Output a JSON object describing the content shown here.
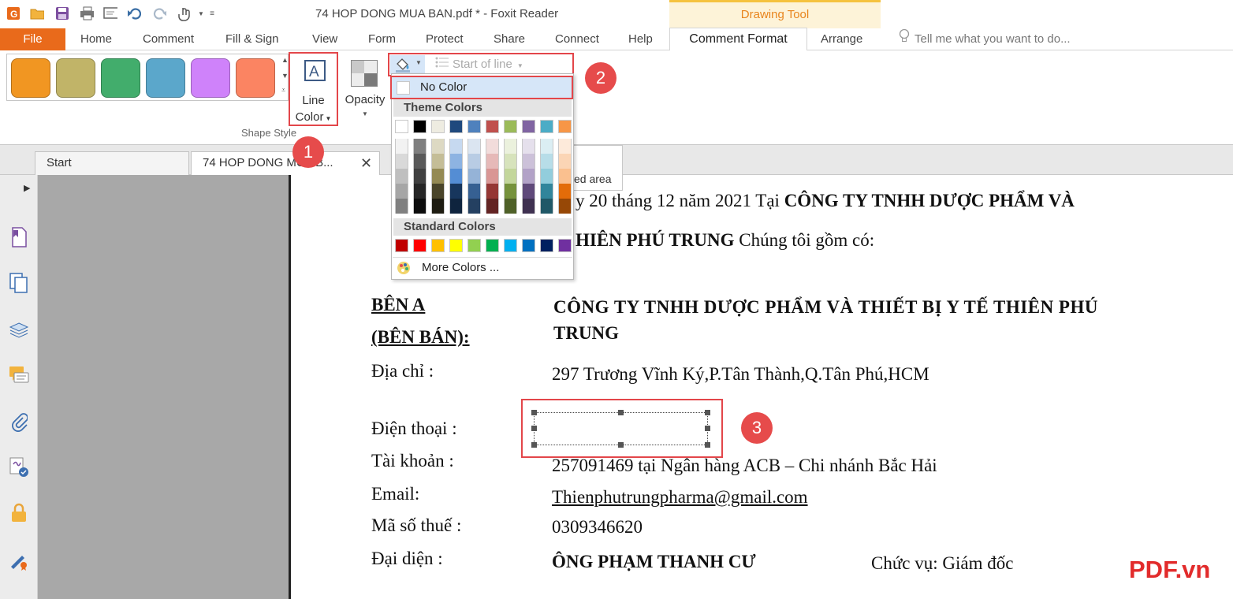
{
  "window": {
    "title": "74 HOP DONG MUA BAN.pdf * - Foxit Reader",
    "context_tab_group": "Drawing Tool"
  },
  "ribbon_tabs": {
    "file": "File",
    "items": [
      "Home",
      "Comment",
      "Fill & Sign",
      "View",
      "Form",
      "Protect",
      "Share",
      "Connect",
      "Help"
    ],
    "active": "Comment Format",
    "arrange": "Arrange",
    "tell_me_placeholder": "Tell me what you want to do..."
  },
  "ribbon": {
    "swatches": [
      "#f19622",
      "#c1b468",
      "#42ad6c",
      "#5ba7cb",
      "#cf82fa",
      "#fb8462"
    ],
    "line_color_label_1": "Line",
    "line_color_label_2": "Color",
    "opacity_label": "Opacity",
    "group_label": "Shape Style",
    "start_of_line_label": "Start of line"
  },
  "color_menu": {
    "no_color": "No Color",
    "theme_header": "Theme Colors",
    "theme_top_row": [
      "#ffffff",
      "#000000",
      "#eeece1",
      "#1f497d",
      "#4f81bd",
      "#c0504d",
      "#9bbb59",
      "#8064a2",
      "#4bacc6",
      "#f79646"
    ],
    "theme_columns": [
      [
        "#f2f2f2",
        "#d9d9d9",
        "#bfbfbf",
        "#a6a6a6",
        "#808080"
      ],
      [
        "#7f7f7f",
        "#595959",
        "#404040",
        "#262626",
        "#0d0d0d"
      ],
      [
        "#ddd9c3",
        "#c4bd97",
        "#948a54",
        "#4a452a",
        "#1e1c11"
      ],
      [
        "#c6d9f0",
        "#8db3e2",
        "#548dd4",
        "#17365d",
        "#0f243e"
      ],
      [
        "#dbe5f1",
        "#b8cce4",
        "#95b3d7",
        "#366092",
        "#244061"
      ],
      [
        "#f2dcdb",
        "#e6b9b8",
        "#d99694",
        "#953734",
        "#632423"
      ],
      [
        "#ebf1dd",
        "#d7e3bc",
        "#c3d69b",
        "#76923c",
        "#4f6128"
      ],
      [
        "#e5e0ec",
        "#ccc1d9",
        "#b2a2c7",
        "#5f497a",
        "#3f3151"
      ],
      [
        "#dbeef3",
        "#b7dde8",
        "#92cddc",
        "#31859b",
        "#205867"
      ],
      [
        "#fdeada",
        "#fbd5b5",
        "#fac08f",
        "#e36c09",
        "#974806"
      ]
    ],
    "standard_header": "Standard Colors",
    "standard_colors": [
      "#c00000",
      "#ff0000",
      "#ffc000",
      "#ffff00",
      "#92d050",
      "#00b050",
      "#00b0f0",
      "#0070c0",
      "#002060",
      "#7030a0"
    ],
    "more_colors": "More Colors ..."
  },
  "tooltip_text": "ed area",
  "doc_tabs": {
    "start": "Start",
    "document": "74 HOP DONG MUA B..."
  },
  "document": {
    "line1_prefix": "y 20 tháng 12 năm 2021  Tại ",
    "line1_bold": "CÔNG TY TNHH DƯỢC PHẨM VÀ",
    "line2_bold": "HIÊN PHÚ TRUNG",
    "line2_rest": " Chúng tôi gồm có:",
    "party_a": "BÊN A",
    "party_a_role": "(BÊN BÁN):",
    "company_line1": "CÔNG TY TNHH DƯỢC PHẨM  VÀ THIẾT BỊ Y TẾ THIÊN PHÚ",
    "company_line2": "TRUNG",
    "address_label": "Địa chỉ :",
    "address_value": "297 Trương Vĩnh Ký,P.Tân Thành,Q.Tân Phú,HCM",
    "phone_label": "Điện thoại :",
    "account_label": "Tài khoản :",
    "account_value": "257091469 tại Ngân hàng ACB – Chi nhánh Bắc Hải",
    "email_label": "Email:",
    "email_value": "Thienphutrungpharma@gmail.com",
    "tax_label": "Mã số thuế :",
    "tax_value": "0309346620",
    "rep_label": "Đại diện :",
    "rep_value": "ÔNG PHẠM THANH CƯ",
    "position_value": "Chức vụ: Giám đốc"
  },
  "badges": [
    "1",
    "2",
    "3"
  ],
  "watermark": "PDF.vn"
}
